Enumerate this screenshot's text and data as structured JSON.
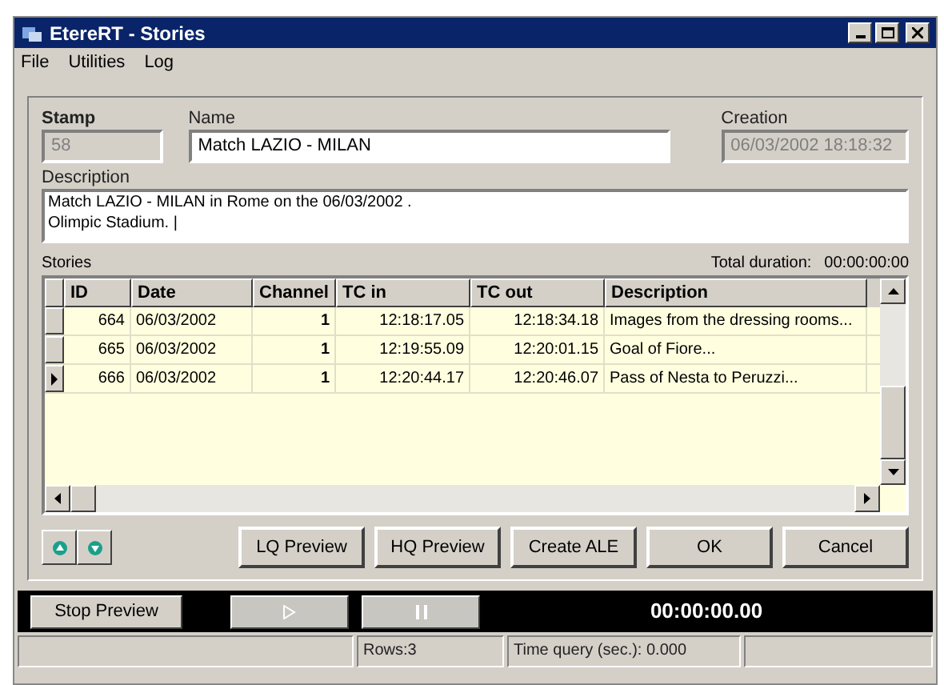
{
  "window": {
    "title": "EtereRT - Stories"
  },
  "menu": [
    "File",
    "Utilities",
    "Log"
  ],
  "fields": {
    "stamp": {
      "label": "Stamp",
      "value": "58",
      "disabled": true
    },
    "name": {
      "label": "Name",
      "value": "Match LAZIO - MILAN",
      "disabled": false
    },
    "creation": {
      "label": "Creation",
      "value": "06/03/2002 18:18:32",
      "disabled": true
    }
  },
  "description": {
    "label": "Description",
    "lines": [
      "Match LAZIO - MILAN in Rome on the 06/03/2002 .",
      "Olimpic Stadium. |"
    ]
  },
  "stories": {
    "label": "Stories",
    "total_label": "Total duration:",
    "total_value": "00:00:00:00",
    "columns": [
      "ID",
      "Date",
      "Channel",
      "TC in",
      "TC out",
      "Description"
    ],
    "rows": [
      {
        "cells": [
          "664",
          "06/03/2002",
          "1",
          "12:18:17.05",
          "12:18:34.18",
          "Images from the dressing rooms..."
        ],
        "selected": false
      },
      {
        "cells": [
          "665",
          "06/03/2002",
          "1",
          "12:19:55.09",
          "12:20:01.15",
          "Goal of Fiore..."
        ],
        "selected": false
      },
      {
        "cells": [
          "666",
          "06/03/2002",
          "1",
          "12:20:44.17",
          "12:20:46.07",
          "Pass of Nesta to Peruzzi..."
        ],
        "selected": true
      }
    ]
  },
  "buttons": [
    "LQ Preview",
    "HQ Preview",
    "Create ALE",
    "OK",
    "Cancel"
  ],
  "preview": {
    "stop": "Stop Preview",
    "controls": [
      {
        "kind": "play",
        "disabled": true
      },
      {
        "kind": "pause",
        "disabled": true
      }
    ],
    "time": "00:00:00.00"
  },
  "status_bar": [
    "Rows:3",
    "Time query (sec.): 0.000"
  ]
}
